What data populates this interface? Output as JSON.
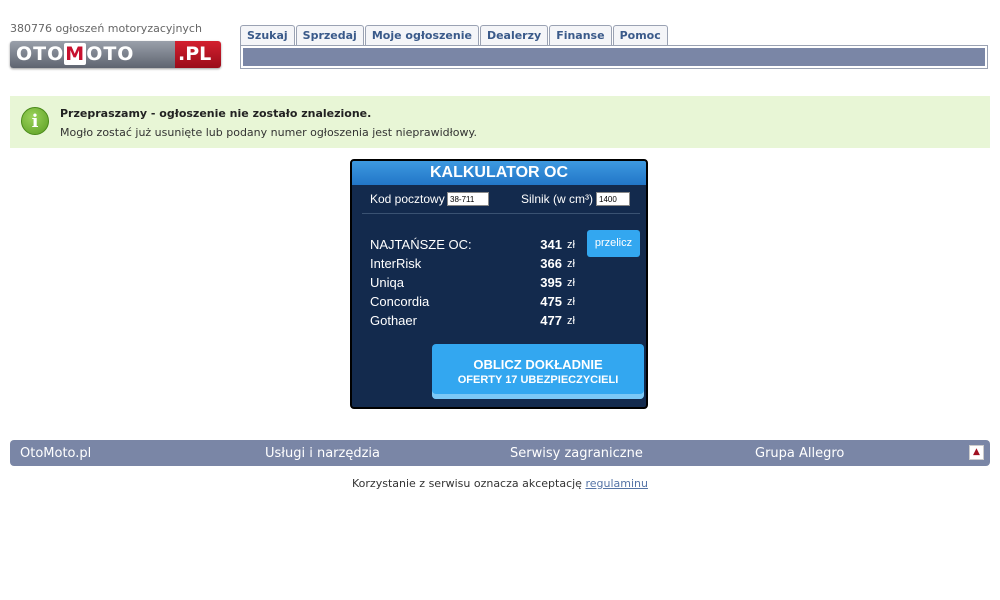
{
  "header": {
    "count_text": "380776 ogłoszeń motoryzacyjnych",
    "logo": {
      "part1a": "OTO",
      "part1b": "M",
      "part1c": "OTO",
      "part2": ".PL"
    },
    "tabs": [
      {
        "label": "Szukaj"
      },
      {
        "label": "Sprzedaj"
      },
      {
        "label": "Moje ogłoszenie"
      },
      {
        "label": "Dealerzy"
      },
      {
        "label": "Finanse"
      },
      {
        "label": "Pomoc"
      }
    ]
  },
  "message": {
    "icon_glyph": "i",
    "title": "Przepraszamy - ogłoszenie nie zostało znalezione.",
    "text": "Mogło zostać już usunięte lub podany numer ogłoszenia jest nieprawidłowy."
  },
  "calculator": {
    "title": "KALKULATOR OC",
    "postal_label": "Kod pocztowy",
    "postal_value": "38-711",
    "engine_label": "Silnik (w cm³)",
    "engine_value": "1400",
    "recalc_button": "przelicz",
    "rows": [
      {
        "name": "NAJTAŃSZE OC:",
        "value": "341",
        "currency": "zł"
      },
      {
        "name": "InterRisk",
        "value": "366",
        "currency": "zł"
      },
      {
        "name": "Uniqa",
        "value": "395",
        "currency": "zł"
      },
      {
        "name": "Concordia",
        "value": "475",
        "currency": "zł"
      },
      {
        "name": "Gothaer",
        "value": "477",
        "currency": "zł"
      }
    ],
    "cta_line1": "OBLICZ DOKŁADNIE",
    "cta_line2": "OFERTY 17 UBEZPIECZYCIELI"
  },
  "footer": {
    "items": [
      {
        "label": "OtoMoto.pl"
      },
      {
        "label": "Usługi i narzędzia"
      },
      {
        "label": "Serwisy zagraniczne"
      },
      {
        "label": "Grupa Allegro"
      }
    ],
    "terms_text": "Korzystanie z serwisu oznacza akceptację",
    "terms_link": "regulaminu"
  },
  "colors": {
    "navbar": "#7a86a6",
    "message_bg": "#e8f6d6",
    "calc_bg": "#132a4d",
    "calc_accent": "#33a7f0",
    "logo_red": "#c8102e"
  }
}
